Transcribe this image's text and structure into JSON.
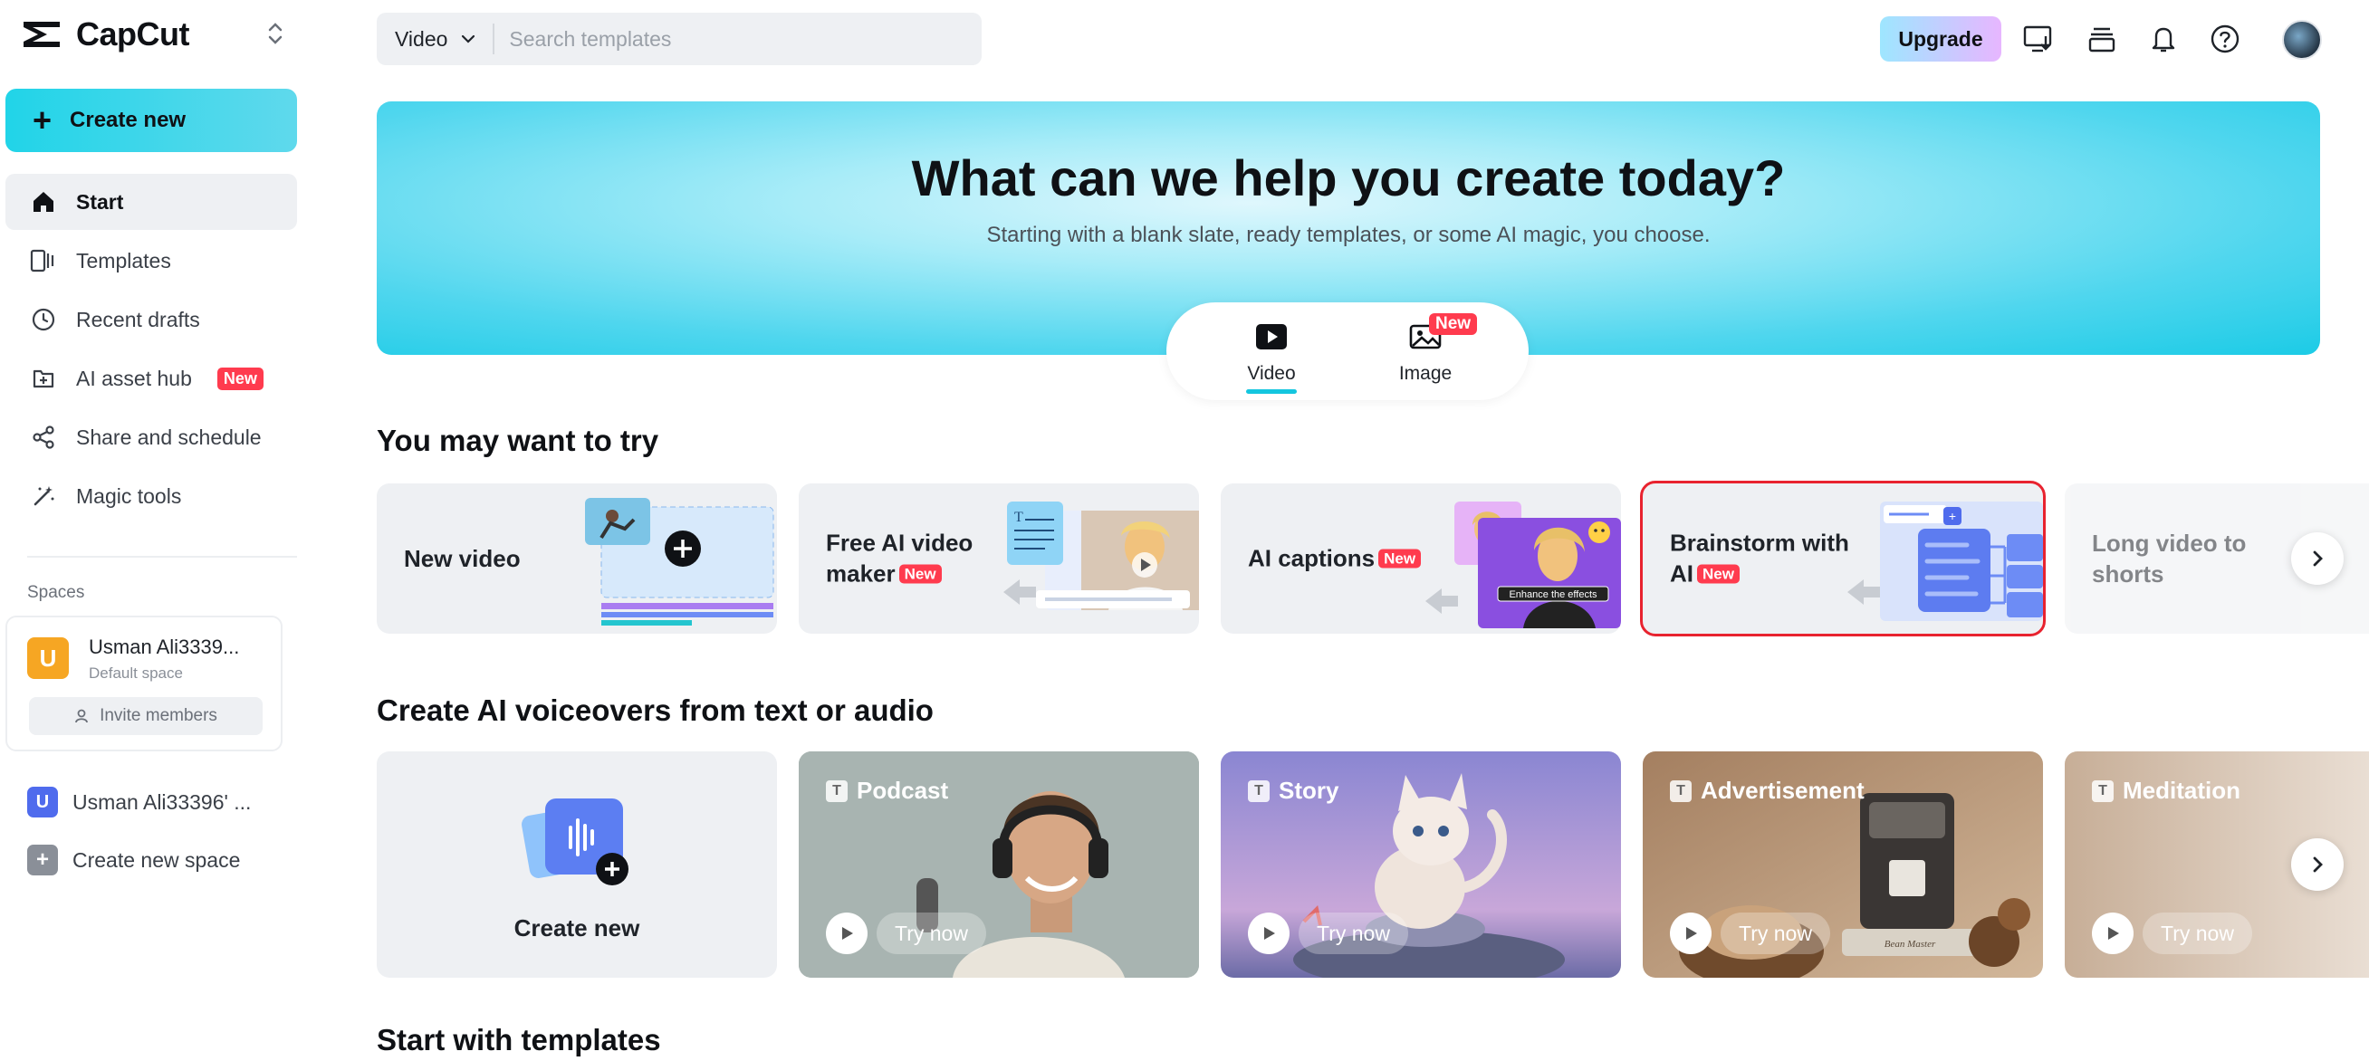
{
  "app": {
    "name": "CapCut"
  },
  "sidebar": {
    "create_label": "Create new",
    "items": [
      {
        "label": "Start",
        "icon": "home-icon",
        "active": true
      },
      {
        "label": "Templates",
        "icon": "templates-icon"
      },
      {
        "label": "Recent drafts",
        "icon": "clock-icon"
      },
      {
        "label": "AI asset hub",
        "icon": "asset-hub-icon",
        "badge": "New"
      },
      {
        "label": "Share and schedule",
        "icon": "share-icon"
      },
      {
        "label": "Magic tools",
        "icon": "magic-wand-icon"
      }
    ],
    "spaces_title": "Spaces",
    "space_card": {
      "avatar_letter": "U",
      "name": "Usman Ali3339...",
      "subtitle": "Default space",
      "invite_label": "Invite members"
    },
    "other_space": {
      "avatar_letter": "U",
      "name": "Usman Ali33396' ..."
    },
    "create_space_label": "Create new space"
  },
  "topbar": {
    "search_type": "Video",
    "search_placeholder": "Search templates",
    "upgrade_label": "Upgrade",
    "icons": [
      "monitor-download-icon",
      "layers-icon",
      "bell-icon",
      "help-icon",
      "user-avatar"
    ]
  },
  "hero": {
    "title": "What can we help you create today?",
    "subtitle": "Starting with a blank slate, ready templates, or some AI magic, you choose.",
    "tabs": [
      {
        "label": "Video",
        "icon": "video-play-icon",
        "active": true
      },
      {
        "label": "Image",
        "icon": "image-icon",
        "badge": "New"
      }
    ]
  },
  "try_section": {
    "title": "You may want to try",
    "cards": [
      {
        "label": "New video"
      },
      {
        "label": "Free AI video maker",
        "badge": "New"
      },
      {
        "label": "AI captions",
        "badge": "New",
        "overlay_text": "Enhance the effects"
      },
      {
        "label": "Brainstorm with AI",
        "badge": "New",
        "highlighted": true
      },
      {
        "label": "Long video to shorts"
      }
    ]
  },
  "voice_section": {
    "title": "Create AI voiceovers from text or audio",
    "create_label": "Create new",
    "cards": [
      {
        "label": "Podcast",
        "action": "Try now"
      },
      {
        "label": "Story",
        "action": "Try now"
      },
      {
        "label": "Advertisement",
        "action": "Try now",
        "package_text": "Bean Master"
      },
      {
        "label": "Meditation",
        "action": "Try now"
      }
    ]
  },
  "templates_section": {
    "title": "Start with templates"
  },
  "colors": {
    "accent": "#14c6df",
    "badge": "#ff3b4e",
    "highlight_border": "#e8232f"
  }
}
